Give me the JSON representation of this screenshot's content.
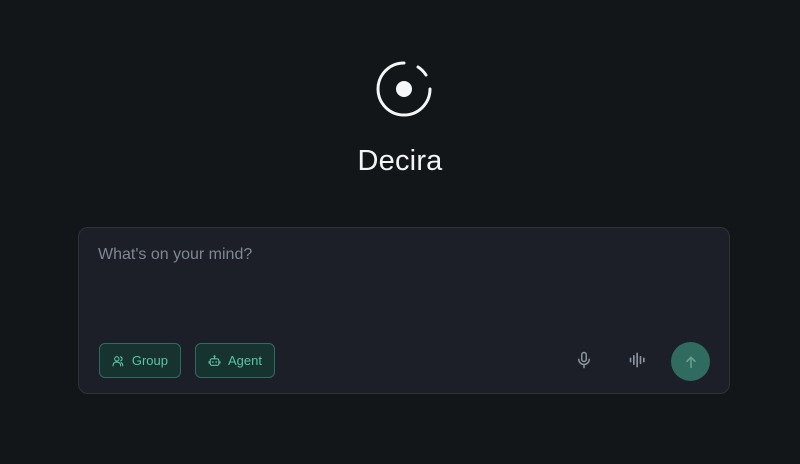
{
  "app": {
    "title": "Decira",
    "logo_icon": "radio-target-logo"
  },
  "composer": {
    "placeholder": "What's on your mind?",
    "value": ""
  },
  "chips": {
    "group": {
      "label": "Group",
      "icon": "users-icon"
    },
    "agent": {
      "label": "Agent",
      "icon": "robot-icon"
    }
  },
  "actions": {
    "mic_icon": "microphone-icon",
    "voice_icon": "waveform-icon",
    "send_icon": "arrow-up-icon"
  },
  "colors": {
    "background": "#131619",
    "panel": "#1c1f27",
    "accent": "#54c7a5",
    "accent_fill": "#17332f",
    "send_button": "#2f6b5e"
  }
}
